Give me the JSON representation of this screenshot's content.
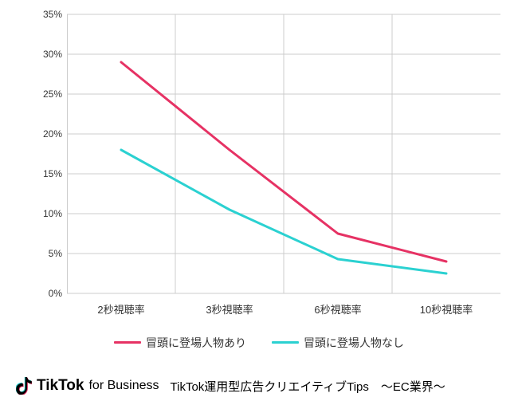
{
  "chart_data": {
    "type": "line",
    "categories": [
      "2秒視聴率",
      "3秒視聴率",
      "6秒視聴率",
      "10秒視聴率"
    ],
    "series": [
      {
        "name": "冒頭に登場人物あり",
        "values": [
          29,
          18,
          7.5,
          4
        ],
        "color": "#e63264"
      },
      {
        "name": "冒頭に登場人物なし",
        "values": [
          18,
          10.5,
          4.3,
          2.5
        ],
        "color": "#2bd1d1"
      }
    ],
    "ylabel": "",
    "xlabel": "",
    "ylim": [
      0,
      35
    ],
    "ytick_step": 5,
    "ytick_suffix": "%"
  },
  "legend": {
    "items": [
      {
        "label": "冒頭に登場人物あり",
        "color": "#e63264"
      },
      {
        "label": "冒頭に登場人物なし",
        "color": "#2bd1d1"
      }
    ]
  },
  "footer": {
    "logo_main": "TikTok",
    "logo_sub": "for Business",
    "tagline": "TikTok運用型広告クリエイティブTips　〜EC業界〜"
  }
}
